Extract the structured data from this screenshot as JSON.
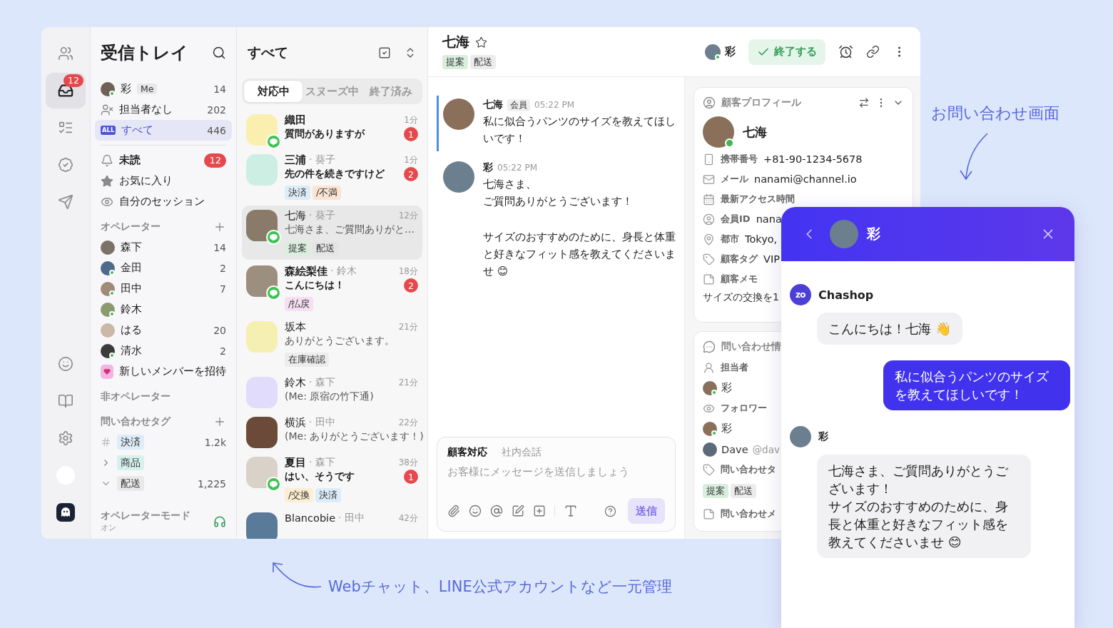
{
  "rail": {
    "items": [
      {
        "selected": false
      },
      {
        "selected": true,
        "badge": "12"
      },
      {
        "selected": false
      },
      {
        "selected": false
      },
      {
        "selected": false
      }
    ]
  },
  "sidebar": {
    "title": "受信トレイ",
    "inboxes": [
      {
        "kind": "me",
        "label": "彩",
        "tag": "Me",
        "count": "14",
        "online": true,
        "selected": false
      },
      {
        "kind": "unassigned",
        "label": "担当者なし",
        "count": "202",
        "selected": false
      },
      {
        "kind": "all",
        "icon_text": "ALL",
        "label": "すべて",
        "count": "446",
        "selected": true
      }
    ],
    "filters": [
      {
        "kind": "bell",
        "label": "未読",
        "badge": "12",
        "unread": true
      },
      {
        "kind": "star",
        "label": "お気に入り",
        "unread": false
      },
      {
        "kind": "eye",
        "label": "自分のセッション",
        "unread": false
      }
    ],
    "operators": {
      "title": "オペレーター",
      "members": [
        {
          "name": "森下",
          "count": "14",
          "online": false
        },
        {
          "name": "金田",
          "count": "2",
          "online": true
        },
        {
          "name": "田中",
          "count": "7",
          "online": true
        },
        {
          "name": "鈴木",
          "online": true
        },
        {
          "name": "はる",
          "count": "20",
          "online": false
        },
        {
          "name": "清水",
          "count": "2",
          "online": true
        }
      ],
      "invite": "新しいメンバーを招待"
    },
    "non_operators": {
      "title": "非オペレーター"
    },
    "tags": {
      "title": "問い合わせタグ",
      "items": [
        {
          "kind": "tag",
          "label": "決済",
          "count": "1.2k",
          "color": "#dcecf8"
        },
        {
          "kind": "group",
          "expanded": false,
          "label": "商品",
          "color": "#d6f1ec"
        },
        {
          "kind": "group",
          "expanded": true,
          "label": "配送",
          "count": "1,225",
          "color": "#e9e9ea"
        }
      ]
    },
    "mode": {
      "label": "オペレーターモード",
      "value": "オン",
      "on": true
    }
  },
  "list": {
    "title": "すべて",
    "tabs": [
      {
        "label": "対応中",
        "selected": true
      },
      {
        "label": "スヌーズ中",
        "selected": false
      },
      {
        "label": "終了済み",
        "selected": false
      }
    ],
    "conversations": [
      {
        "name": "織田",
        "time": "1分",
        "preview": "質問がありますが",
        "unread": "1",
        "line": true,
        "selected": false
      },
      {
        "name": "三浦",
        "assignee": "· 葵子",
        "time": "1分",
        "preview": "先の件を続きですけど",
        "unread": "2",
        "line": false,
        "selected": false,
        "tags": [
          {
            "label": "決済",
            "color": "#dcecf8"
          },
          {
            "label": "/不満",
            "color": "#fbe5d2"
          }
        ]
      },
      {
        "name": "七海",
        "assignee": "· 葵子",
        "time": "12分",
        "preview": "七海さま、ご質問ありがと…",
        "line": true,
        "selected": true,
        "tags": [
          {
            "label": "提案",
            "color": "#d9eedd"
          },
          {
            "label": "配送",
            "color": "#e4e4e5"
          }
        ]
      },
      {
        "name": "森絵梨佳",
        "assignee": "· 鈴木",
        "time": "18分",
        "preview": "こんにちは！",
        "unread": "2",
        "line": true,
        "selected": false,
        "tags": [
          {
            "label": "/払戻",
            "color": "#f6def3"
          }
        ]
      },
      {
        "name": "坂本",
        "time": "21分",
        "preview": "ありがとうございます。",
        "line": false,
        "selected": false,
        "tags": [
          {
            "label": "在庫確認",
            "color": "#ececec"
          }
        ]
      },
      {
        "name": "鈴木",
        "assignee": "· 森下",
        "time": "21分",
        "preview": "(Me: 原宿の竹下通)",
        "line": false,
        "selected": false
      },
      {
        "name": "横浜",
        "assignee": "· 田中",
        "time": "22分",
        "preview": "(Me: ありがとうございます！)",
        "line": false,
        "selected": false
      },
      {
        "name": "夏目",
        "assignee": "· 森下",
        "time": "38分",
        "preview": "はい、そうです",
        "unread": "1",
        "line": true,
        "selected": false,
        "tags": [
          {
            "label": "/交換",
            "color": "#fbeed2"
          },
          {
            "label": "決済",
            "color": "#dcecf8"
          }
        ]
      },
      {
        "name": "Blancobie",
        "assignee": "· 田中",
        "time": "42分",
        "line": false,
        "selected": false
      }
    ]
  },
  "chat": {
    "header": {
      "title": "七海",
      "starred": false,
      "tags": [
        {
          "label": "提案",
          "color": "#d9eedd"
        },
        {
          "label": "配送",
          "color": "#ececec"
        }
      ],
      "assignee": "彩",
      "assignee_online": true,
      "close_button": "終了する"
    },
    "messages": [
      {
        "author": "七海",
        "role": "会員",
        "time": "05:22 PM",
        "paragraphs": [
          [
            "私に似合うパンツのサイズを教えてほしいです！"
          ]
        ],
        "highlighted": true
      },
      {
        "author": "彩",
        "time": "05:22 PM",
        "paragraphs": [
          [
            "七海さま、",
            "ご質問ありがとうございます！"
          ],
          [
            "サイズのおすすめのために、身長と体重と好きなフィット感を教えてくださいませ 😊"
          ]
        ],
        "highlighted": false
      }
    ],
    "composer": {
      "tabs": [
        {
          "label": "顧客対応",
          "selected": true
        },
        {
          "label": "社内会話",
          "selected": false
        }
      ],
      "placeholder": "お客様にメッセージを送信しましょう",
      "send": "送信",
      "send_disabled": true
    }
  },
  "profile": {
    "title": "顧客プロフィール",
    "name": "七海",
    "online": true,
    "fields": [
      {
        "kind": "phone",
        "label": "携帯番号",
        "value": "+81-90-1234-5678"
      },
      {
        "kind": "mail",
        "label": "メール",
        "value": "nanami@channel.io"
      },
      {
        "kind": "calendar",
        "label": "最新アクセス時間"
      },
      {
        "kind": "user",
        "label": "会員ID",
        "value": "nana"
      },
      {
        "kind": "pin",
        "label": "都市",
        "value": "Tokyo,"
      },
      {
        "kind": "tag",
        "label": "顧客タグ",
        "value": "VIP"
      },
      {
        "kind": "note",
        "label": "顧客メモ"
      }
    ],
    "memo": "サイズの交換を1"
  },
  "info": {
    "title": "問い合わせ情",
    "sections": [
      {
        "kind": "assignee",
        "label": "担当者",
        "people": [
          {
            "name": "彩",
            "online": true
          }
        ]
      },
      {
        "kind": "followers",
        "label": "フォロワー",
        "people": [
          {
            "name": "彩",
            "online": true
          },
          {
            "name": "Dave",
            "handle": "@dav",
            "online": false
          }
        ]
      },
      {
        "kind": "tags",
        "label": "問い合わせタ",
        "tags": [
          {
            "label": "提案",
            "color": "#d9eedd"
          },
          {
            "label": "配送",
            "color": "#ececec"
          }
        ]
      },
      {
        "kind": "note",
        "label": "問い合わせメ"
      }
    ]
  },
  "widget": {
    "title": "彩",
    "messages": [
      {
        "kind": "bot",
        "author": "Chashop",
        "logo": "zo",
        "lines": [
          "こんにちは！七海 👋"
        ]
      },
      {
        "kind": "user",
        "lines": [
          "私に似合うパンツのサイズを教えてほしいです！"
        ]
      },
      {
        "kind": "agent",
        "author": "彩",
        "lines": [
          "七海さま、ご質問ありがとうございます！",
          "サイズのおすすめのために、身長と体重と好きなフィット感を教えてくださいませ 😊"
        ]
      }
    ]
  },
  "annotations": [
    {
      "kind": "down",
      "text": "お問い合わせ画面"
    },
    {
      "kind": "left",
      "text": "Webチャット、LINE公式アカウントなど一元管理"
    }
  ]
}
